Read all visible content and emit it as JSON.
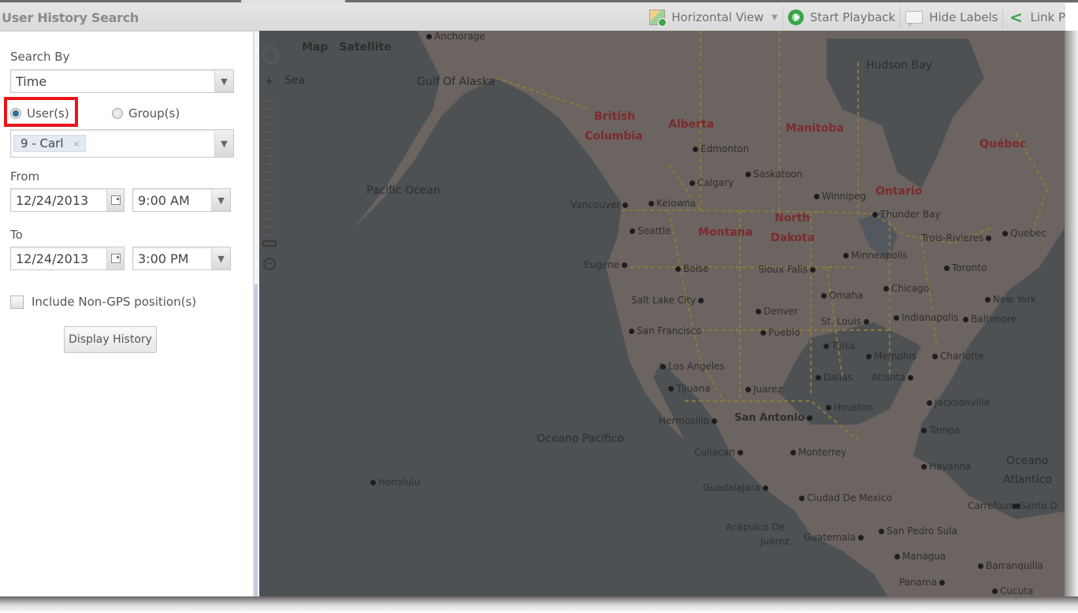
{
  "header": {
    "title": "User History Search",
    "toolbar": [
      {
        "icon": "horizontal-view-icon",
        "label": "Horizontal View",
        "has_dropdown": true
      },
      {
        "icon": "play-icon",
        "label": "Start Playback"
      },
      {
        "icon": "labels-icon",
        "label": "Hide Labels"
      },
      {
        "icon": "link-icon",
        "label": "Link P"
      }
    ]
  },
  "form": {
    "search_by_label": "Search By",
    "search_by_value": "Time",
    "radio_users": "User(s)",
    "radio_groups": "Group(s)",
    "selected_radio": "users",
    "selected_user_tag": "9 - Carl",
    "tag_remove": "×",
    "from_label": "From",
    "from_date": "12/24/2013",
    "from_time": "9:00 AM",
    "to_label": "To",
    "to_date": "12/24/2013",
    "to_time": "3:00 PM",
    "non_gps_label": "Include Non-GPS position(s)",
    "non_gps_checked": false,
    "display_button": "Display History",
    "highlight_color": "#e8141a"
  },
  "map": {
    "type_buttons": {
      "map": "Map",
      "satellite": "Satellite"
    },
    "zoom_in": "+",
    "zoom_out": "−",
    "oceans": [
      "Hudson Bay",
      "Gulf Of Alaska",
      "Pacific Ocean",
      "Oceano Pacifico",
      "Oceano",
      "Atlantico",
      "Sea"
    ],
    "regions": [
      "British",
      "Columbia",
      "Alberta",
      "Manitoba",
      "Québec",
      "Ontario",
      "North",
      "Dakota",
      "Montana"
    ],
    "cities": [
      "Anchorage",
      "Edmonton",
      "Saskatoon",
      "Calgary",
      "Winnipeg",
      "Vancouver",
      "Kelowna",
      "Thunder Bay",
      "Seattle",
      "Trois-Rivieres",
      "Quebec",
      "Minneapolis",
      "Eugene",
      "Boise",
      "Sioux Falls",
      "Toronto",
      "Chicago",
      "New York",
      "Omaha",
      "Salt Lake City",
      "Denver",
      "Indianapolis",
      "Baltimore",
      "St. Louis",
      "San Francisco",
      "Pueblo",
      "Tulsa",
      "Memphis",
      "Charlotte",
      "Los Angeles",
      "Atlanta",
      "Dallas",
      "Tijuana",
      "Juarez",
      "Houston",
      "Jacksonville",
      "Hermosillo",
      "San Antonio",
      "Tampa",
      "Culiacan",
      "Monterrey",
      "Havanna",
      "Guadalajara",
      "Ciudad De Mexico",
      "Carrefour",
      "Santo D",
      "Acapulco De",
      "Juarez",
      "Guatemala",
      "San Pedro Sula",
      "Managua",
      "Barranquilla",
      "Panama",
      "Cucuta",
      "Honolulu"
    ]
  }
}
